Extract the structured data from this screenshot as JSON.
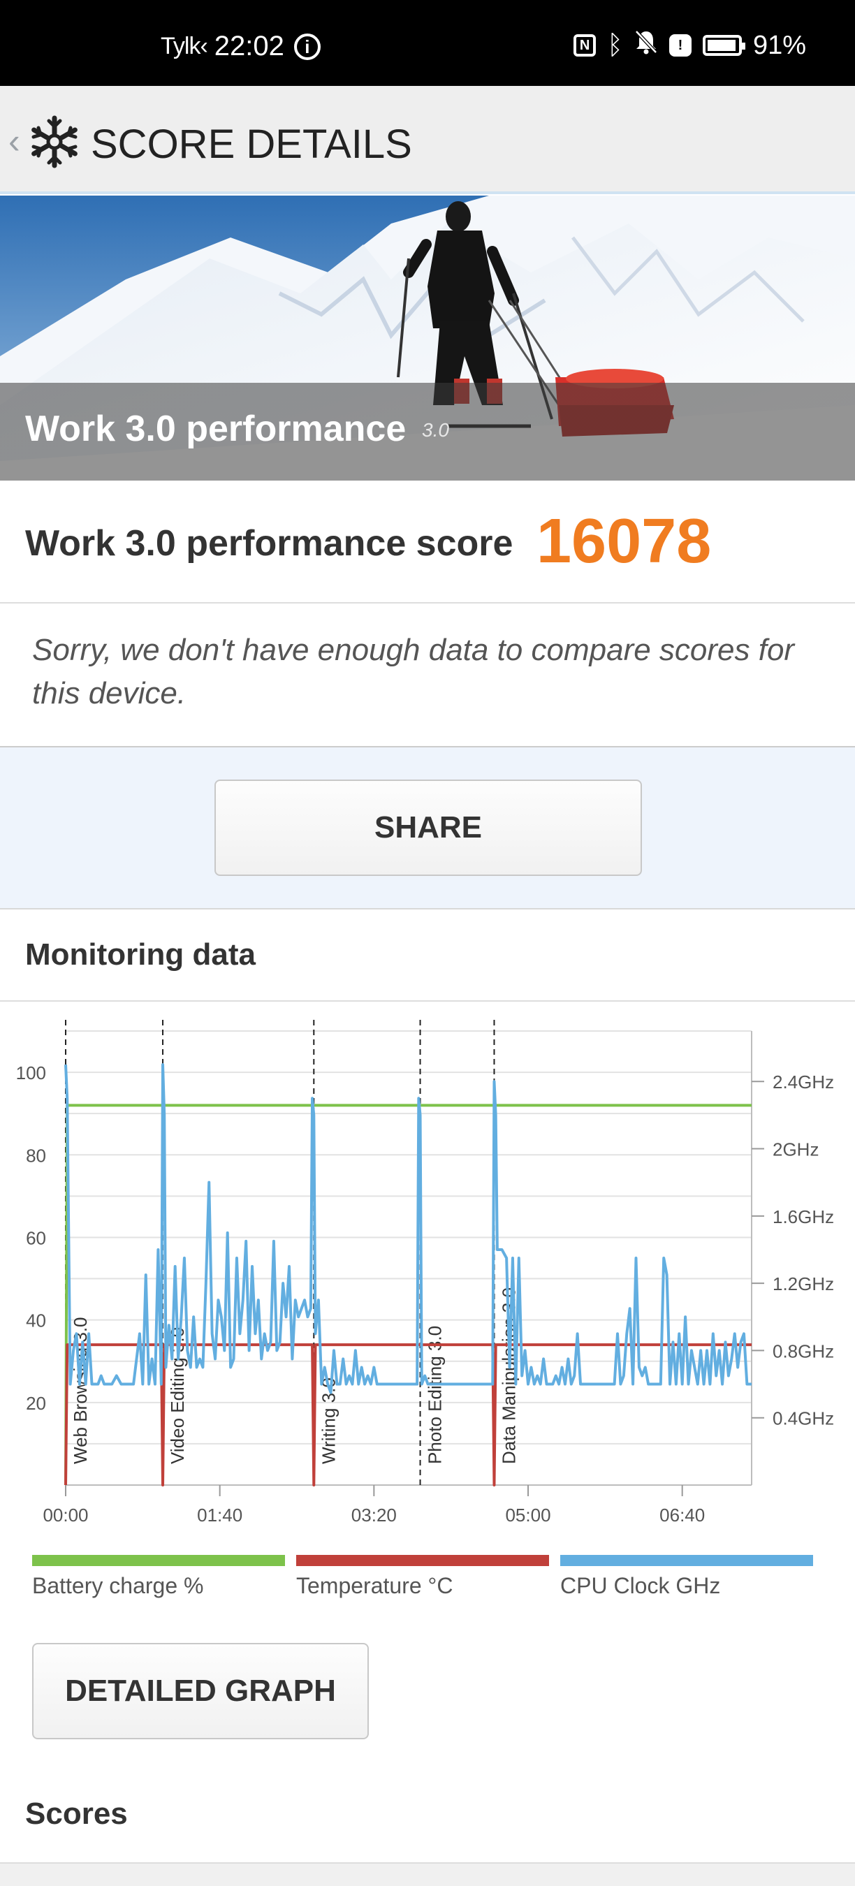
{
  "status_bar": {
    "carrier": "Tylk‹",
    "time": "22:02",
    "battery_percent": "91%",
    "icons": [
      "info-icon",
      "nfc-icon",
      "bluetooth-icon",
      "bell-off-icon",
      "alert-icon",
      "battery-icon"
    ]
  },
  "app_bar": {
    "title": "SCORE DETAILS",
    "back_icon": "chevron-left-icon",
    "logo_icon": "snowflake-icon"
  },
  "hero": {
    "title": "Work 3.0 performance",
    "version": "3.0"
  },
  "score": {
    "label": "Work 3.0 performance score",
    "value": "16078",
    "value_color": "#f07c20"
  },
  "compare": {
    "message": "Sorry, we don't have enough data to compare scores for this device."
  },
  "share": {
    "label": "SHARE"
  },
  "monitoring": {
    "title": "Monitoring data",
    "detailed_graph_label": "DETAILED GRAPH"
  },
  "scores": {
    "heading": "Scores"
  },
  "chart_data": {
    "type": "line",
    "x_ticks": [
      "00:00",
      "01:40",
      "03:20",
      "05:00",
      "06:40"
    ],
    "x_range_seconds": [
      0,
      445
    ],
    "y_left_ticks": [
      "100",
      "80",
      "60",
      "40",
      "20"
    ],
    "y_left_range": [
      0,
      110
    ],
    "y_right_ticks": [
      "2.4GHz",
      "2GHz",
      "1.6GHz",
      "1.2GHz",
      "0.8GHz",
      "0.4GHz"
    ],
    "y_right_range_ghz": [
      0,
      2.7
    ],
    "grid": true,
    "legend_position": "bottom",
    "sections": [
      {
        "name": "Web Browsing 3.0",
        "start_s": 0
      },
      {
        "name": "Video Editing 3.0",
        "start_s": 63
      },
      {
        "name": "Writing 3.0",
        "start_s": 161
      },
      {
        "name": "Photo Editing 3.0",
        "start_s": 230
      },
      {
        "name": "Data Manipulation 3.0",
        "start_s": 278
      }
    ],
    "series": [
      {
        "name": "Battery charge %",
        "color": "#7dc24b",
        "points": [
          [
            0,
            0
          ],
          [
            1,
            92
          ],
          [
            445,
            92
          ]
        ]
      },
      {
        "name": "Temperature °C",
        "color": "#c0403a",
        "points": [
          [
            0,
            0
          ],
          [
            1,
            34
          ],
          [
            62,
            34
          ],
          [
            63,
            0
          ],
          [
            64,
            34
          ],
          [
            160,
            34
          ],
          [
            161,
            0
          ],
          [
            162,
            34
          ],
          [
            277,
            34
          ],
          [
            278,
            0
          ],
          [
            279,
            34
          ],
          [
            445,
            34
          ]
        ]
      },
      {
        "name": "CPU Clock GHz",
        "color": "#62aee0",
        "points_ghz": [
          [
            0,
            2.5
          ],
          [
            1,
            2.3
          ],
          [
            3,
            0.6
          ],
          [
            5,
            0.8
          ],
          [
            7,
            0.9
          ],
          [
            9,
            0.6
          ],
          [
            11,
            0.85
          ],
          [
            13,
            0.6
          ],
          [
            15,
            0.9
          ],
          [
            17,
            0.6
          ],
          [
            19,
            0.6
          ],
          [
            21,
            0.6
          ],
          [
            23,
            0.65
          ],
          [
            25,
            0.6
          ],
          [
            27,
            0.6
          ],
          [
            30,
            0.6
          ],
          [
            33,
            0.65
          ],
          [
            36,
            0.6
          ],
          [
            40,
            0.6
          ],
          [
            44,
            0.6
          ],
          [
            48,
            0.9
          ],
          [
            50,
            0.6
          ],
          [
            52,
            1.25
          ],
          [
            54,
            0.6
          ],
          [
            56,
            0.75
          ],
          [
            58,
            0.6
          ],
          [
            60,
            1.4
          ],
          [
            62,
            0.6
          ],
          [
            63,
            2.5
          ],
          [
            64,
            2.2
          ],
          [
            65,
            0.7
          ],
          [
            67,
            0.95
          ],
          [
            69,
            0.75
          ],
          [
            71,
            1.3
          ],
          [
            73,
            0.75
          ],
          [
            75,
            1.0
          ],
          [
            77,
            1.35
          ],
          [
            79,
            0.8
          ],
          [
            81,
            0.7
          ],
          [
            83,
            1.0
          ],
          [
            85,
            0.7
          ],
          [
            87,
            0.75
          ],
          [
            89,
            0.7
          ],
          [
            91,
            1.2
          ],
          [
            93,
            1.8
          ],
          [
            95,
            0.9
          ],
          [
            97,
            0.75
          ],
          [
            99,
            1.1
          ],
          [
            101,
            1.0
          ],
          [
            103,
            0.8
          ],
          [
            105,
            1.5
          ],
          [
            107,
            0.7
          ],
          [
            109,
            0.75
          ],
          [
            111,
            1.35
          ],
          [
            113,
            0.9
          ],
          [
            115,
            1.1
          ],
          [
            117,
            1.45
          ],
          [
            119,
            0.8
          ],
          [
            121,
            1.3
          ],
          [
            123,
            0.9
          ],
          [
            125,
            1.1
          ],
          [
            127,
            0.75
          ],
          [
            129,
            0.9
          ],
          [
            131,
            0.8
          ],
          [
            133,
            0.85
          ],
          [
            135,
            1.45
          ],
          [
            137,
            0.8
          ],
          [
            139,
            0.85
          ],
          [
            141,
            1.2
          ],
          [
            143,
            1.0
          ],
          [
            145,
            1.3
          ],
          [
            147,
            0.75
          ],
          [
            149,
            1.1
          ],
          [
            151,
            1.0
          ],
          [
            153,
            1.05
          ],
          [
            155,
            1.1
          ],
          [
            157,
            1.0
          ],
          [
            159,
            1.05
          ],
          [
            160,
            2.3
          ],
          [
            161,
            2.2
          ],
          [
            162,
            0.9
          ],
          [
            164,
            1.1
          ],
          [
            166,
            0.6
          ],
          [
            168,
            0.7
          ],
          [
            170,
            0.6
          ],
          [
            172,
            0.55
          ],
          [
            174,
            0.8
          ],
          [
            176,
            0.6
          ],
          [
            178,
            0.6
          ],
          [
            180,
            0.75
          ],
          [
            182,
            0.6
          ],
          [
            184,
            0.65
          ],
          [
            186,
            0.6
          ],
          [
            188,
            0.8
          ],
          [
            190,
            0.6
          ],
          [
            192,
            0.7
          ],
          [
            194,
            0.6
          ],
          [
            196,
            0.65
          ],
          [
            198,
            0.6
          ],
          [
            200,
            0.7
          ],
          [
            202,
            0.6
          ],
          [
            206,
            0.6
          ],
          [
            210,
            0.6
          ],
          [
            214,
            0.6
          ],
          [
            218,
            0.6
          ],
          [
            222,
            0.6
          ],
          [
            226,
            0.6
          ],
          [
            228,
            0.6
          ],
          [
            229,
            2.3
          ],
          [
            230,
            2.2
          ],
          [
            231,
            0.6
          ],
          [
            233,
            0.65
          ],
          [
            235,
            0.6
          ],
          [
            240,
            0.6
          ],
          [
            245,
            0.6
          ],
          [
            250,
            0.6
          ],
          [
            255,
            0.6
          ],
          [
            260,
            0.6
          ],
          [
            265,
            0.6
          ],
          [
            270,
            0.6
          ],
          [
            275,
            0.6
          ],
          [
            277,
            0.6
          ],
          [
            278,
            2.4
          ],
          [
            279,
            2.2
          ],
          [
            280,
            1.4
          ],
          [
            283,
            1.4
          ],
          [
            286,
            1.35
          ],
          [
            288,
            0.7
          ],
          [
            290,
            1.35
          ],
          [
            292,
            0.6
          ],
          [
            294,
            1.35
          ],
          [
            296,
            0.65
          ],
          [
            298,
            0.8
          ],
          [
            300,
            0.6
          ],
          [
            302,
            0.7
          ],
          [
            304,
            0.6
          ],
          [
            306,
            0.65
          ],
          [
            308,
            0.6
          ],
          [
            310,
            0.75
          ],
          [
            312,
            0.6
          ],
          [
            314,
            0.6
          ],
          [
            316,
            0.6
          ],
          [
            318,
            0.65
          ],
          [
            320,
            0.6
          ],
          [
            322,
            0.7
          ],
          [
            324,
            0.6
          ],
          [
            326,
            0.75
          ],
          [
            328,
            0.6
          ],
          [
            330,
            0.65
          ],
          [
            332,
            0.9
          ],
          [
            334,
            0.6
          ],
          [
            336,
            0.6
          ],
          [
            338,
            0.6
          ],
          [
            340,
            0.6
          ],
          [
            342,
            0.6
          ],
          [
            344,
            0.6
          ],
          [
            346,
            0.6
          ],
          [
            348,
            0.6
          ],
          [
            350,
            0.6
          ],
          [
            352,
            0.6
          ],
          [
            354,
            0.6
          ],
          [
            356,
            0.6
          ],
          [
            358,
            0.9
          ],
          [
            360,
            0.6
          ],
          [
            362,
            0.65
          ],
          [
            364,
            0.9
          ],
          [
            366,
            1.05
          ],
          [
            368,
            0.6
          ],
          [
            370,
            1.35
          ],
          [
            372,
            0.7
          ],
          [
            374,
            0.65
          ],
          [
            376,
            0.7
          ],
          [
            378,
            0.6
          ],
          [
            380,
            0.6
          ],
          [
            382,
            0.6
          ],
          [
            384,
            0.6
          ],
          [
            386,
            0.6
          ],
          [
            388,
            1.35
          ],
          [
            390,
            1.25
          ],
          [
            392,
            0.6
          ],
          [
            394,
            0.85
          ],
          [
            396,
            0.6
          ],
          [
            398,
            0.9
          ],
          [
            400,
            0.6
          ],
          [
            402,
            1.0
          ],
          [
            404,
            0.6
          ],
          [
            406,
            0.8
          ],
          [
            408,
            0.7
          ],
          [
            410,
            0.6
          ],
          [
            412,
            0.8
          ],
          [
            414,
            0.6
          ],
          [
            416,
            0.8
          ],
          [
            418,
            0.6
          ],
          [
            420,
            0.9
          ],
          [
            422,
            0.65
          ],
          [
            424,
            0.8
          ],
          [
            426,
            0.6
          ],
          [
            428,
            0.85
          ],
          [
            430,
            0.65
          ],
          [
            432,
            0.75
          ],
          [
            434,
            0.9
          ],
          [
            436,
            0.7
          ],
          [
            438,
            0.85
          ],
          [
            440,
            0.9
          ],
          [
            442,
            0.6
          ],
          [
            445,
            0.6
          ]
        ]
      }
    ]
  }
}
